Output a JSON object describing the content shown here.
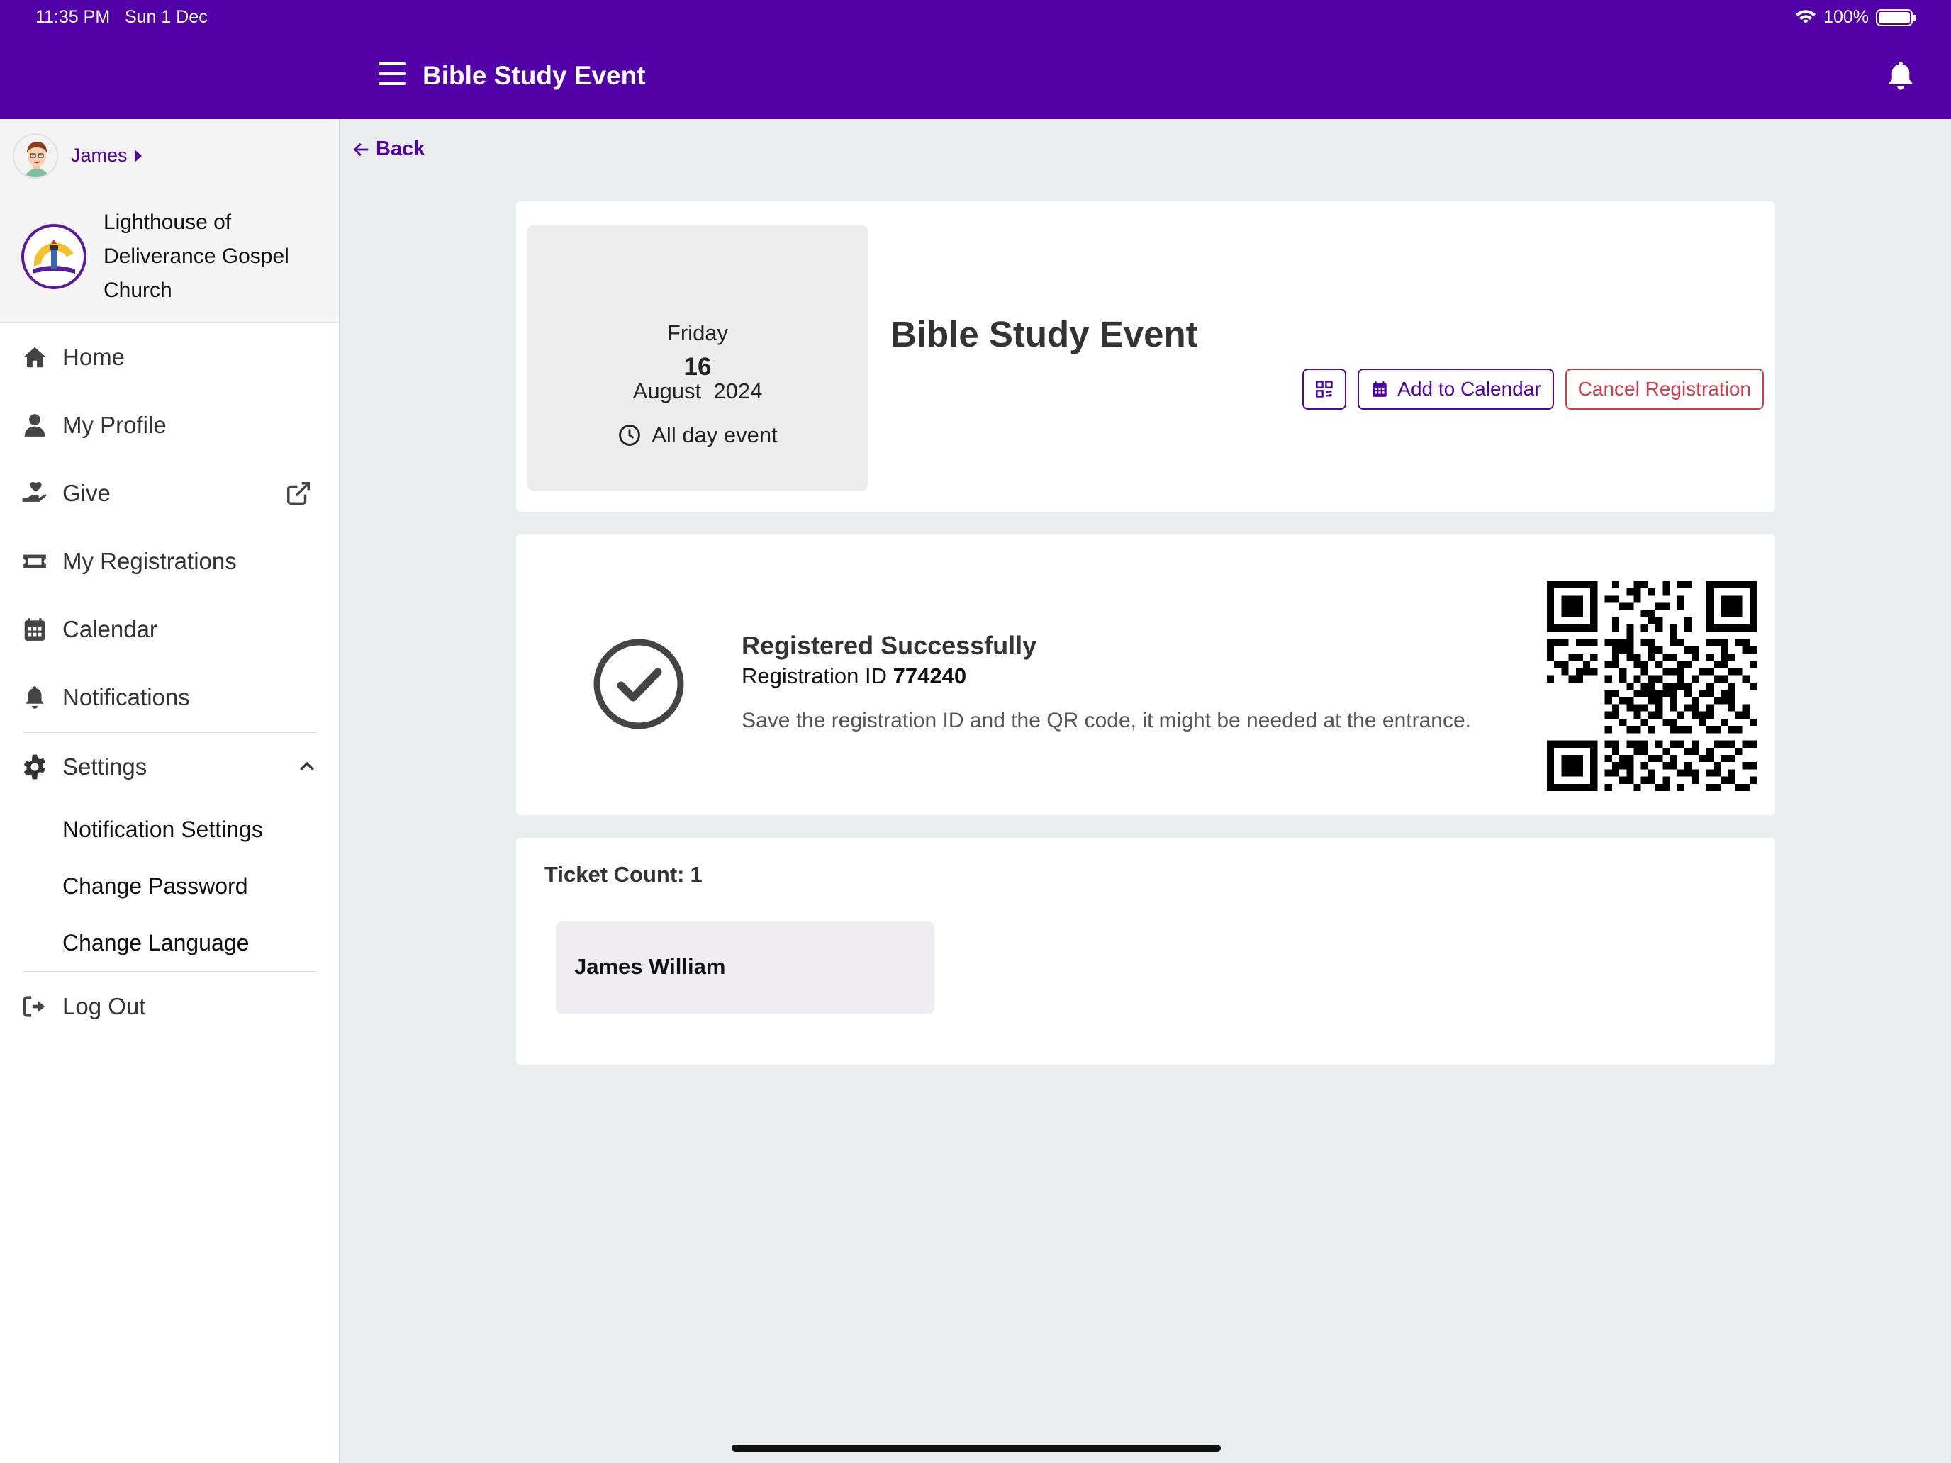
{
  "status_bar": {
    "time": "11:35 PM",
    "date": "Sun 1 Dec",
    "battery": "100%"
  },
  "header": {
    "title": "Bible Study Event"
  },
  "sidebar": {
    "user": "James",
    "church": {
      "name": "Lighthouse of Deliverance Gospel Church"
    },
    "items": [
      {
        "label": "Home",
        "icon": "home-icon"
      },
      {
        "label": "My Profile",
        "icon": "user-icon"
      },
      {
        "label": "Give",
        "icon": "give-hand-heart-icon"
      },
      {
        "label": "My Registrations",
        "icon": "ticket-icon"
      },
      {
        "label": "Calendar",
        "icon": "calendar-icon"
      },
      {
        "label": "Notifications",
        "icon": "bell-icon"
      }
    ],
    "settings": {
      "label": "Settings",
      "subitems": [
        "Notification Settings",
        "Change Password",
        "Change Language"
      ]
    },
    "logout": "Log Out"
  },
  "main": {
    "back": "Back",
    "event": {
      "weekday": "Friday",
      "day": "16",
      "month_year": "August  2024",
      "time": "All day event",
      "title": "Bible Study Event",
      "add_to_calendar": "Add to Calendar",
      "cancel_registration": "Cancel Registration"
    },
    "registration": {
      "title": "Registered Successfully",
      "id_label": "Registration ID",
      "id_value": "774240",
      "note": "Save the registration ID and the QR code, it might be needed at the entrance."
    },
    "tickets": {
      "count_label": "Ticket Count:",
      "count": "1",
      "attendees": [
        "James William"
      ]
    }
  },
  "colors": {
    "brand": "#5200a8",
    "danger": "#d33a4a",
    "background": "#ebeeef"
  }
}
